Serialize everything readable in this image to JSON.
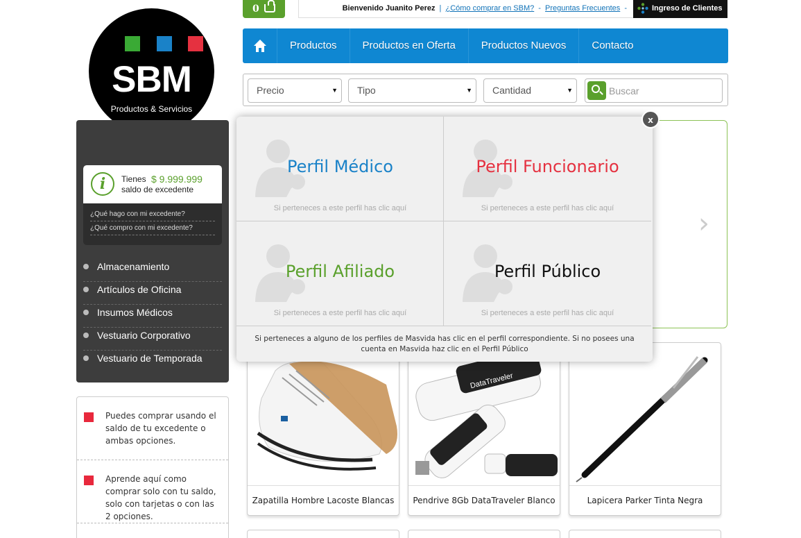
{
  "brand": {
    "name": "SBM",
    "tagline": "Productos & Servicios"
  },
  "topbar": {
    "cart_count": "0",
    "welcome": "Bienvenido Juanito Perez",
    "links": [
      "¿Cómo comprar en SBM?",
      "Preguntas Frecuentes"
    ],
    "login_label": "Ingreso de Clientes"
  },
  "nav": {
    "items": [
      "Productos",
      "Productos en Oferta",
      "Productos Nuevos",
      "Contacto"
    ]
  },
  "filters": {
    "selects": [
      "Precio",
      "Tipo",
      "Cantidad"
    ],
    "search_placeholder": "Buscar"
  },
  "balance": {
    "label": "Tienes",
    "amount": "$ 9.999.999",
    "sublabel": "saldo de excedente",
    "links": [
      "¿Qué hago con mi excedente?",
      "¿Qué compro con mi excedente?"
    ]
  },
  "categories": [
    "Almacenamiento",
    "Artículos de Oficina",
    "Insumos Médicos",
    "Vestuario Corporativo",
    "Vestuario de Temporada"
  ],
  "info_panel": [
    "Puedes comprar usando el saldo de tu excedente o ambas opciones.",
    "Aprende aquí como comprar solo con tu saldo, solo con tarjetas o con las 2 opciones."
  ],
  "products": [
    "Zapatilla Hombre Lacoste Blancas",
    "Pendrive 8Gb DataTraveler Blanco",
    "Lapicera Parker Tinta Negra"
  ],
  "modal": {
    "close_label": "x",
    "profiles": [
      {
        "name": "Perfil Médico",
        "hint": "Si perteneces a este perfil has clic aquí",
        "color": "#1a82c8"
      },
      {
        "name": "Perfil Funcionario",
        "hint": "Si perteneces a este perfil has clic aquí",
        "color": "#e53140"
      },
      {
        "name": "Perfil Afiliado",
        "hint": "Si perteneces a este perfil has clic aquí",
        "color": "#5aa02c"
      },
      {
        "name": "Perfil Público",
        "hint": "Si perteneces a este perfil has clic aquí",
        "color": "#111111"
      }
    ],
    "footer": "Si perteneces a alguno de los perfiles de Masvida has clic en el perfil correspondiente. Si no posees una cuenta en Masvida haz clic en el Perfil Público"
  },
  "colors": {
    "brand_green": "#5aa02c",
    "brand_blue": "#0f87d2",
    "brand_red": "#e8283c",
    "logo_squares": [
      "#3aaa35",
      "#1a82c8",
      "#e53140"
    ]
  }
}
